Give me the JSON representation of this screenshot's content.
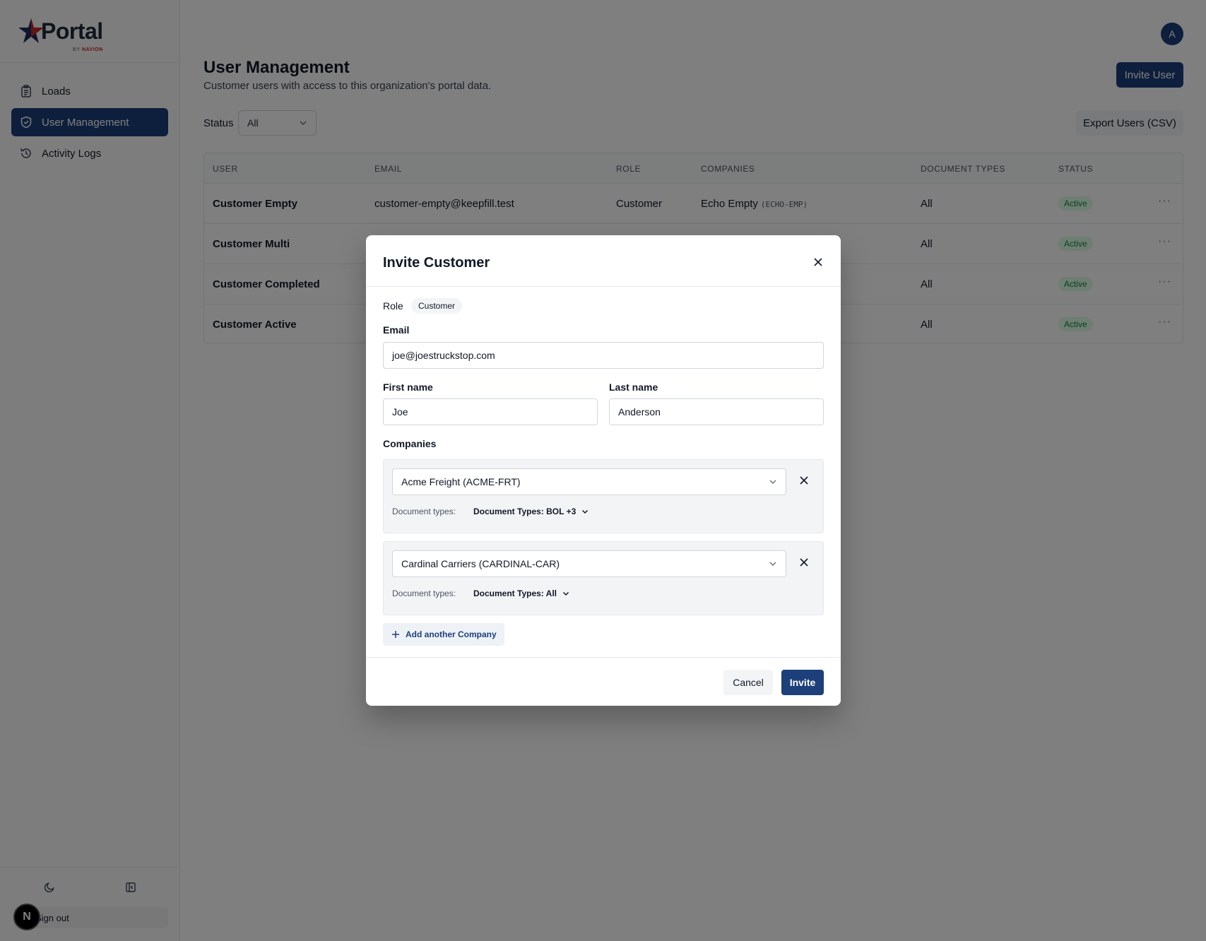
{
  "brand": {
    "name": "Portal",
    "sub_prefix": "BY ",
    "sub_brand": "NAVION"
  },
  "sidebar": {
    "items": [
      {
        "label": "Loads",
        "icon": "clipboard-icon",
        "active": false
      },
      {
        "label": "User Management",
        "icon": "shield-icon",
        "active": true
      },
      {
        "label": "Activity Logs",
        "icon": "history-icon",
        "active": false
      }
    ],
    "sign_out": "Sign out",
    "badge": "N"
  },
  "header": {
    "avatar_initial": "A"
  },
  "page": {
    "title": "User Management",
    "subtitle": "Customer users with access to this organization's portal data.",
    "invite_user": "Invite User",
    "status_label": "Status",
    "status_value": "All",
    "export_label": "Export Users (CSV)"
  },
  "table": {
    "headers": [
      "USER",
      "EMAIL",
      "ROLE",
      "COMPANIES",
      "DOCUMENT TYPES",
      "STATUS"
    ],
    "rows": [
      {
        "user": "Customer Empty",
        "email": "customer-empty@keepfill.test",
        "role": "Customer",
        "company": "Echo Empty",
        "company_code": "(ECHO-EMP)",
        "doc_types": "All",
        "status": "Active"
      },
      {
        "user": "Customer Multi",
        "email": "",
        "role": "",
        "company": "",
        "company_code": "",
        "doc_types": "All",
        "status": "Active"
      },
      {
        "user": "Customer Completed",
        "email": "",
        "role": "",
        "company": "",
        "company_code": "",
        "doc_types": "All",
        "status": "Active"
      },
      {
        "user": "Customer Active",
        "email": "",
        "role": "",
        "company": "",
        "company_code": "",
        "doc_types": "All",
        "status": "Active"
      }
    ],
    "row_menu": "···"
  },
  "modal": {
    "title": "Invite Customer",
    "role_label": "Role",
    "role_value": "Customer",
    "email_label": "Email",
    "email_value": "joe@joestruckstop.com",
    "first_name_label": "First name",
    "first_name_value": "Joe",
    "last_name_label": "Last name",
    "last_name_value": "Anderson",
    "companies_label": "Companies",
    "companies": [
      {
        "name": "Acme Freight (ACME-FRT)",
        "doc_label": "Document types:",
        "doc_value": "Document Types: BOL +3"
      },
      {
        "name": "Cardinal Carriers (CARDINAL-CAR)",
        "doc_label": "Document types:",
        "doc_value": "Document Types: All"
      }
    ],
    "add_company": "Add another Company",
    "cancel": "Cancel",
    "invite": "Invite"
  },
  "colors": {
    "primary": "#1d3f7a",
    "active_badge_bg": "#dcfce7",
    "active_badge_fg": "#15803d",
    "brand_red": "#c62828"
  }
}
